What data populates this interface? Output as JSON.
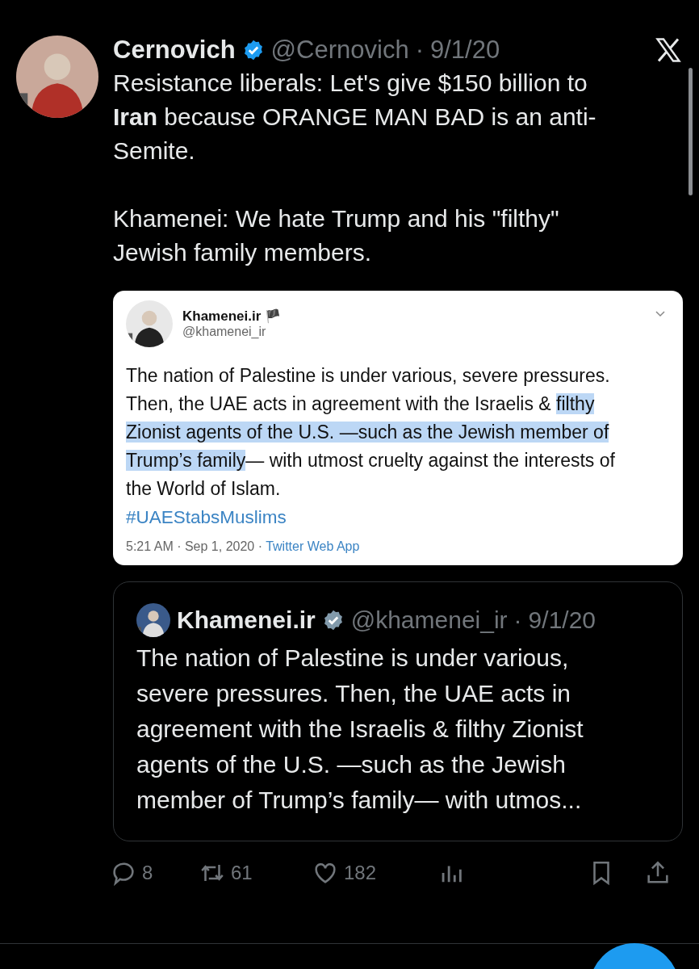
{
  "tweet": {
    "name": "Cernovich",
    "verified": true,
    "handle": "@Cernovich",
    "separator": "·",
    "date": "9/1/20",
    "text": "Resistance liberals: Let's give $150 billion to **Iran** because ORANGE MAN BAD is an anti-Semite.\n\nKhamenei: We hate Trump and his \"filthy\" Jewish family members."
  },
  "screenshot": {
    "name": "Khamenei.ir",
    "flag": "🏴",
    "handle": "@khamenei_ir",
    "segments": [
      {
        "text": "The nation of Palestine is under various, severe pressures. Then, the UAE acts in agreement with the Israelis & ",
        "highlighted": false
      },
      {
        "text": "filthy Zionist agents of the U.S. —such as the Jewish member of Trump’s family",
        "highlighted": true
      },
      {
        "text": "— with utmost cruelty against the interests of the World of Islam.",
        "highlighted": false
      }
    ],
    "hashtag": "#UAEStabsMuslims",
    "time": "5:21 AM · Sep 1, 2020 · ",
    "source": "Twitter Web App"
  },
  "quote": {
    "name": "Khamenei.ir",
    "verified": true,
    "handle": "@khamenei_ir",
    "separator": "·",
    "date": "9/1/20",
    "text": "The nation of Palestine is under various, severe pressures. Then, the UAE acts in agreement with the Israelis & filthy Zionist agents of the U.S. —such as the Jewish member of Trump’s family— with utmos..."
  },
  "actions": [
    {
      "kind": "reply",
      "count": "8"
    },
    {
      "kind": "retweet",
      "count": "61"
    },
    {
      "kind": "like",
      "count": "182"
    },
    {
      "kind": "views"
    },
    {
      "kind": "bookmark"
    },
    {
      "kind": "share"
    }
  ]
}
